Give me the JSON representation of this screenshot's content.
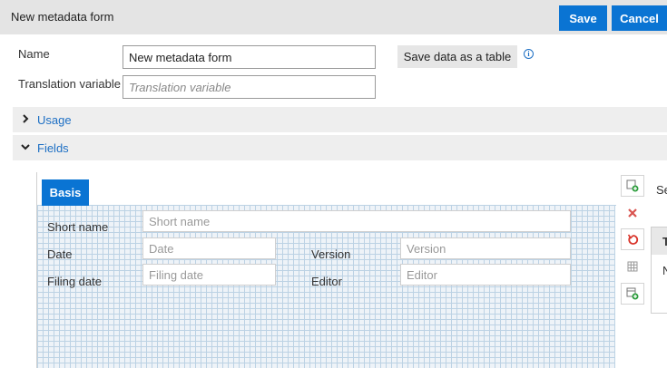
{
  "header": {
    "title": "New metadata form",
    "save_label": "Save",
    "cancel_label": "Cancel",
    "accent_color": "#0a74d3"
  },
  "form": {
    "name_label": "Name",
    "name_value": "New metadata form",
    "translation_label": "Translation variable",
    "translation_placeholder": "Translation variable",
    "save_table_label": "Save data as a table",
    "info_icon": "info-icon",
    "info_glyph": "i"
  },
  "sections": {
    "usage_label": "Usage",
    "fields_label": "Fields"
  },
  "designer": {
    "tab_label": "Basis",
    "fields": {
      "short_name_label": "Short name",
      "short_name_placeholder": "Short name",
      "date_label": "Date",
      "date_placeholder": "Date",
      "version_label": "Version",
      "version_placeholder": "Version",
      "filing_date_label": "Filing date",
      "filing_date_placeholder": "Filing date",
      "editor_label": "Editor",
      "editor_placeholder": "Editor"
    }
  },
  "toolbar": {
    "icons": [
      "add-field-icon",
      "delete-icon",
      "undo-icon",
      "grid-icon",
      "add-field-icon"
    ]
  },
  "right_panel": {
    "truncated_text": "Se",
    "header_char": "T",
    "row_char": "N"
  }
}
